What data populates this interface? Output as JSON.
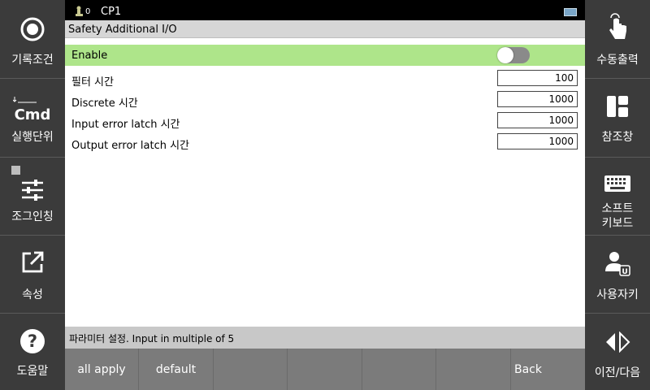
{
  "status_bar": {
    "robot_count": "0",
    "cp_label": "CP1"
  },
  "title": "Safety Additional I/O",
  "rows": {
    "enable": {
      "label": "Enable",
      "on": false
    },
    "filter": {
      "label": "필터 시간",
      "value": "100"
    },
    "discrete": {
      "label": "Discrete 시간",
      "value": "1000"
    },
    "input_latch": {
      "label": "Input error latch 시간",
      "value": "1000"
    },
    "output_latch": {
      "label": "Output error latch 시간",
      "value": "1000"
    }
  },
  "message": "파라미터 설정. Input in multiple of 5",
  "bottom_buttons": [
    "all apply",
    "default",
    "",
    "",
    "",
    "",
    "Back"
  ],
  "left_panel": {
    "record_condition": "기록조건",
    "cmd": "Cmd",
    "exec_unit": "실행단위",
    "jogging": "조그인칭",
    "properties": "속성",
    "help": "도움말"
  },
  "right_panel": {
    "manual_output": "수동출력",
    "reference_window": "참조창",
    "soft_keyboard_line1": "소프트",
    "soft_keyboard_line2": "키보드",
    "user_key": "사용자키",
    "prev_next": "이전/다음"
  },
  "colors": {
    "enable_row": "#aee58a",
    "panel": "#3b3b3b",
    "bottom_bar": "#7b7b7b"
  }
}
